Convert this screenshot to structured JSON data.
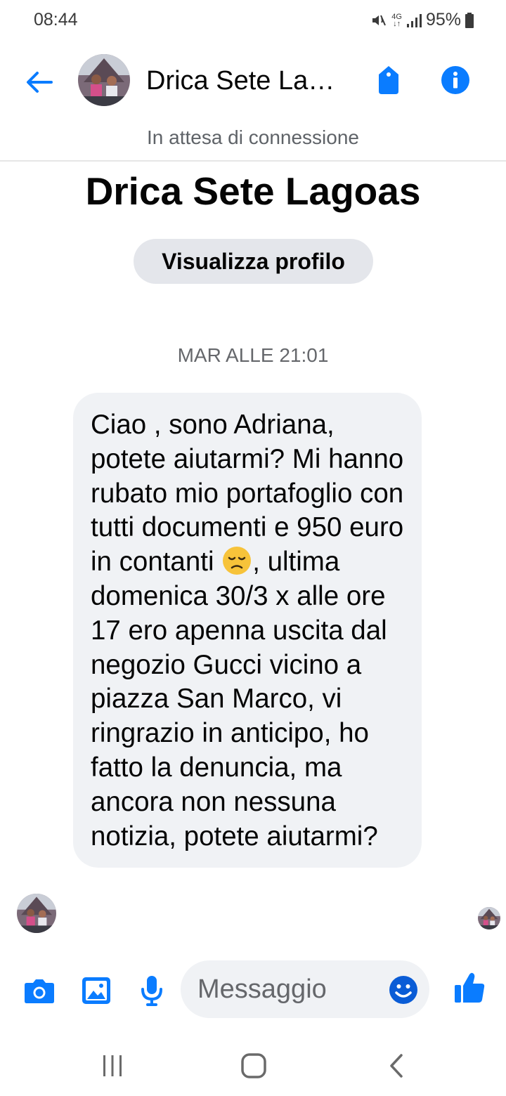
{
  "status_bar": {
    "time": "08:44",
    "network": "4G",
    "battery": "95%",
    "icons": [
      "mute-icon",
      "network-4g-icon",
      "signal-icon",
      "battery-icon"
    ]
  },
  "header": {
    "title": "Drica Sete La…",
    "icons": [
      "back-arrow-icon",
      "avatar",
      "tag-icon",
      "info-icon"
    ],
    "accent_color": "#0a7cff"
  },
  "connection_status": "In attesa di connessione",
  "profile": {
    "name": "Drica Sete Lagoas",
    "view_profile_label": "Visualizza profilo"
  },
  "conversation": {
    "timestamp": "MAR ALLE 21:01",
    "messages": [
      {
        "sender": "incoming",
        "text_before_emoji": "Ciao , sono Adriana, potete aiutarmi? Mi hanno rubato mio portafoglio con tutti documenti e 950 euro in contanti ",
        "emoji": "disappointed-face",
        "text_after_emoji": ", ultima domenica 30/3 x alle ore 17 ero apenna uscita dal negozio Gucci vicino a piazza San Marco, vi ringrazio in anticipo, ho fatto la denuncia, ma ancora non nessuna notizia, potete aiutarmi?"
      }
    ]
  },
  "composer": {
    "placeholder": "Messaggio",
    "icons": [
      "camera-icon",
      "gallery-icon",
      "microphone-icon",
      "emoji-icon",
      "like-thumb-icon"
    ],
    "icon_color": "#0a7cff"
  },
  "nav_bar": {
    "icons": [
      "recent-apps-icon",
      "home-icon",
      "back-icon"
    ]
  }
}
